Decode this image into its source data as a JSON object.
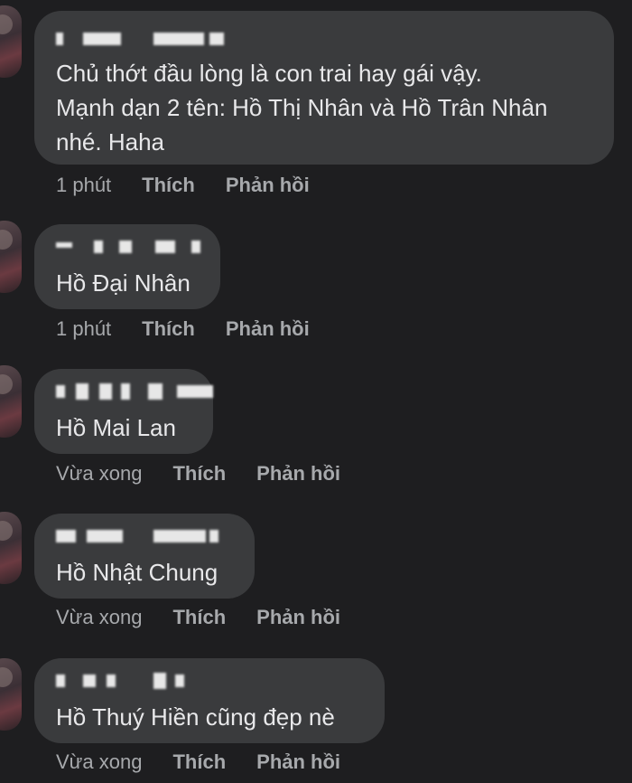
{
  "comments": [
    {
      "text_lines": [
        "Chủ thớt đầu lòng là con trai hay gái vậy.",
        "Mạnh dạn 2 tên: Hồ Thị Nhân và Hồ Trân Nhân",
        "nhé. Haha"
      ],
      "time": "1 phút",
      "like_label": "Thích",
      "reply_label": "Phản hồi"
    },
    {
      "text_lines": [
        "Hồ Đại Nhân"
      ],
      "time": "1 phút",
      "like_label": "Thích",
      "reply_label": "Phản hồi"
    },
    {
      "text_lines": [
        "Hồ Mai Lan"
      ],
      "time": "Vừa xong",
      "like_label": "Thích",
      "reply_label": "Phản hồi"
    },
    {
      "text_lines": [
        "Hồ Nhật Chung"
      ],
      "time": "Vừa xong",
      "like_label": "Thích",
      "reply_label": "Phản hồi"
    },
    {
      "text_lines": [
        "Hồ Thuý Hiền cũng đẹp nè"
      ],
      "time": "Vừa xong",
      "like_label": "Thích",
      "reply_label": "Phản hồi"
    }
  ]
}
